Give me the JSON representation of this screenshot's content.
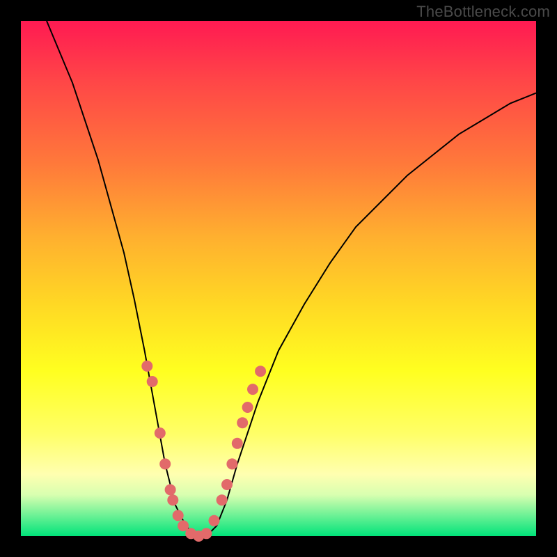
{
  "watermark_text": "TheBottleneck.com",
  "chart_data": {
    "type": "line",
    "title": "",
    "xlabel": "",
    "ylabel": "",
    "xlim": [
      0,
      100
    ],
    "ylim": [
      0,
      100
    ],
    "series": [
      {
        "name": "bottleneck-curve",
        "x": [
          5,
          10,
          15,
          20,
          22,
          24,
          26,
          28,
          30,
          32,
          34,
          36,
          38,
          40,
          42,
          46,
          50,
          55,
          60,
          65,
          70,
          75,
          80,
          85,
          90,
          95,
          100
        ],
        "values": [
          100,
          88,
          73,
          55,
          46,
          36,
          25,
          14,
          6,
          2,
          0,
          0,
          2,
          7,
          14,
          26,
          36,
          45,
          53,
          60,
          65,
          70,
          74,
          78,
          81,
          84,
          86
        ]
      }
    ],
    "markers": {
      "name": "highlight-dots",
      "color": "#e26a6a",
      "x": [
        24.5,
        25.5,
        27,
        28,
        29,
        29.5,
        30.5,
        31.5,
        33,
        34.5,
        36,
        37.5,
        39,
        40,
        41,
        42,
        43,
        44,
        45,
        46.5
      ],
      "values": [
        33,
        30,
        20,
        14,
        9,
        7,
        4,
        2,
        0.5,
        0,
        0.5,
        3,
        7,
        10,
        14,
        18,
        22,
        25,
        28.5,
        32
      ]
    },
    "background_gradient": [
      "#ff1a52",
      "#ff7a3a",
      "#ffd824",
      "#ffff66",
      "#00e37a"
    ]
  }
}
